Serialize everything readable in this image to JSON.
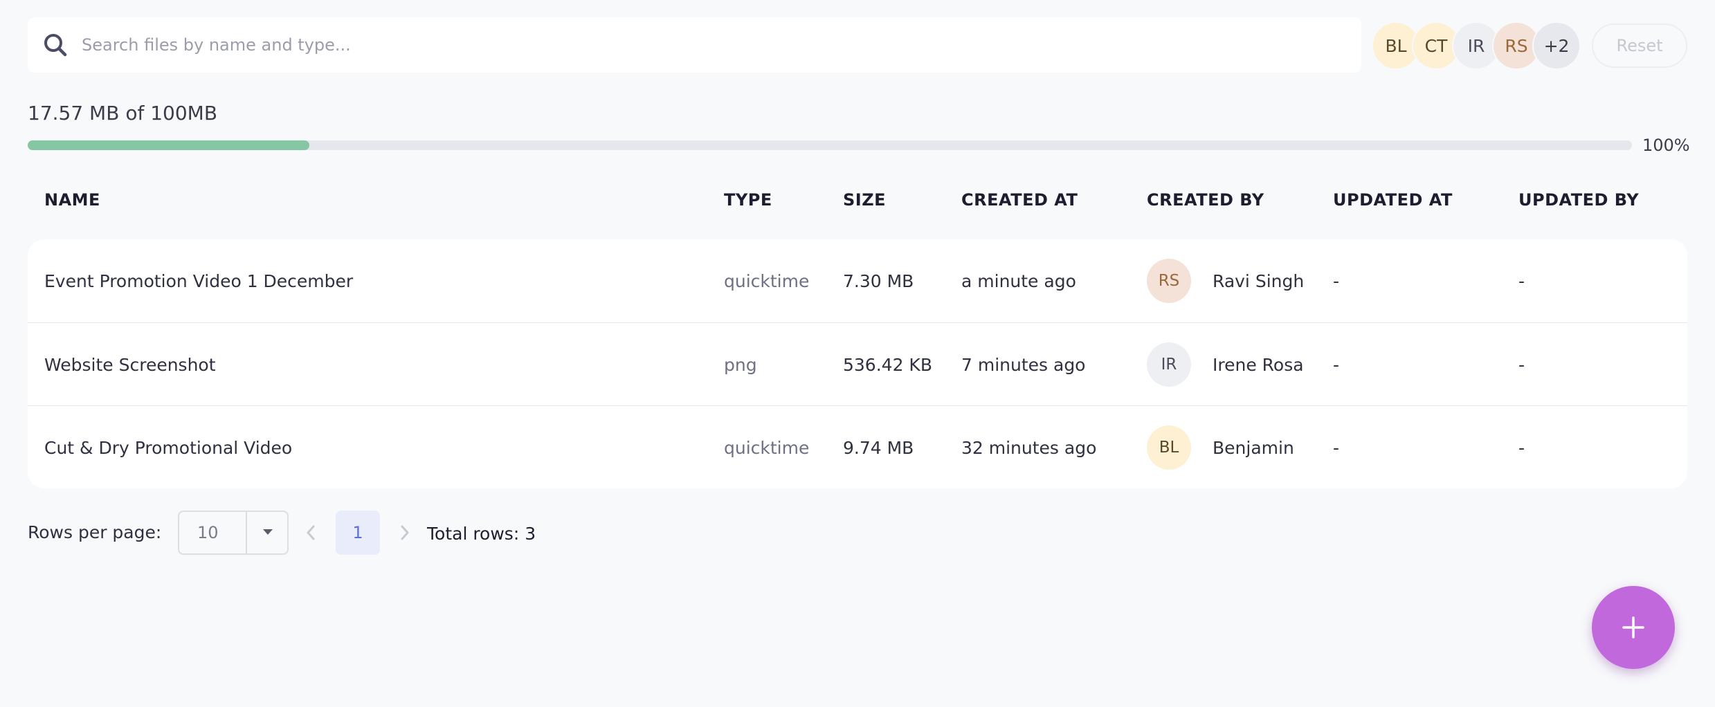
{
  "search": {
    "placeholder": "Search files by name and type..."
  },
  "filters": {
    "avatars": [
      {
        "initials": "BL",
        "bg": "#fdf0d3",
        "fg": "#5a4a2a"
      },
      {
        "initials": "CT",
        "bg": "#fdf0d3",
        "fg": "#5a4a2a"
      },
      {
        "initials": "IR",
        "bg": "#eeeff3",
        "fg": "#4a4c5a"
      },
      {
        "initials": "RS",
        "bg": "#f4e1d8",
        "fg": "#9a6a3a"
      },
      {
        "initials": "+2",
        "bg": "#e7e8ed",
        "fg": "#3b3c4a"
      }
    ],
    "reset_label": "Reset"
  },
  "storage": {
    "used_text": "17.57 MB of 100MB",
    "progress_fraction": 0.1757,
    "progress_label": "100%",
    "bar_color": "#85c7a2"
  },
  "table": {
    "headers": {
      "name": "NAME",
      "type": "TYPE",
      "size": "SIZE",
      "created_at": "CREATED AT",
      "created_by": "CREATED BY",
      "updated_at": "UPDATED AT",
      "updated_by": "UPDATED BY"
    },
    "rows": [
      {
        "name": "Event Promotion Video 1 December",
        "type": "quicktime",
        "size": "7.30 MB",
        "created_at": "a minute ago",
        "created_by": {
          "initials": "RS",
          "name": "Ravi Singh",
          "bg": "#f4e1d8",
          "fg": "#9a6a3a"
        },
        "updated_at": "-",
        "updated_by": "-"
      },
      {
        "name": "Website Screenshot",
        "type": "png",
        "size": "536.42 KB",
        "created_at": "7 minutes ago",
        "created_by": {
          "initials": "IR",
          "name": "Irene Rosa",
          "bg": "#eeeff3",
          "fg": "#4a4c5a"
        },
        "updated_at": "-",
        "updated_by": "-"
      },
      {
        "name": "Cut & Dry Promotional Video",
        "type": "quicktime",
        "size": "9.74 MB",
        "created_at": "32 minutes ago",
        "created_by": {
          "initials": "BL",
          "name": "Benjamin",
          "bg": "#fdf0d3",
          "fg": "#5a4a2a"
        },
        "updated_at": "-",
        "updated_by": "-"
      }
    ]
  },
  "pagination": {
    "rows_per_page_label": "Rows per page:",
    "rows_per_page_value": "10",
    "current_page": "1",
    "total_rows_label": "Total rows: 3"
  },
  "fab": {
    "icon": "plus-icon",
    "color": "#c268dd"
  }
}
